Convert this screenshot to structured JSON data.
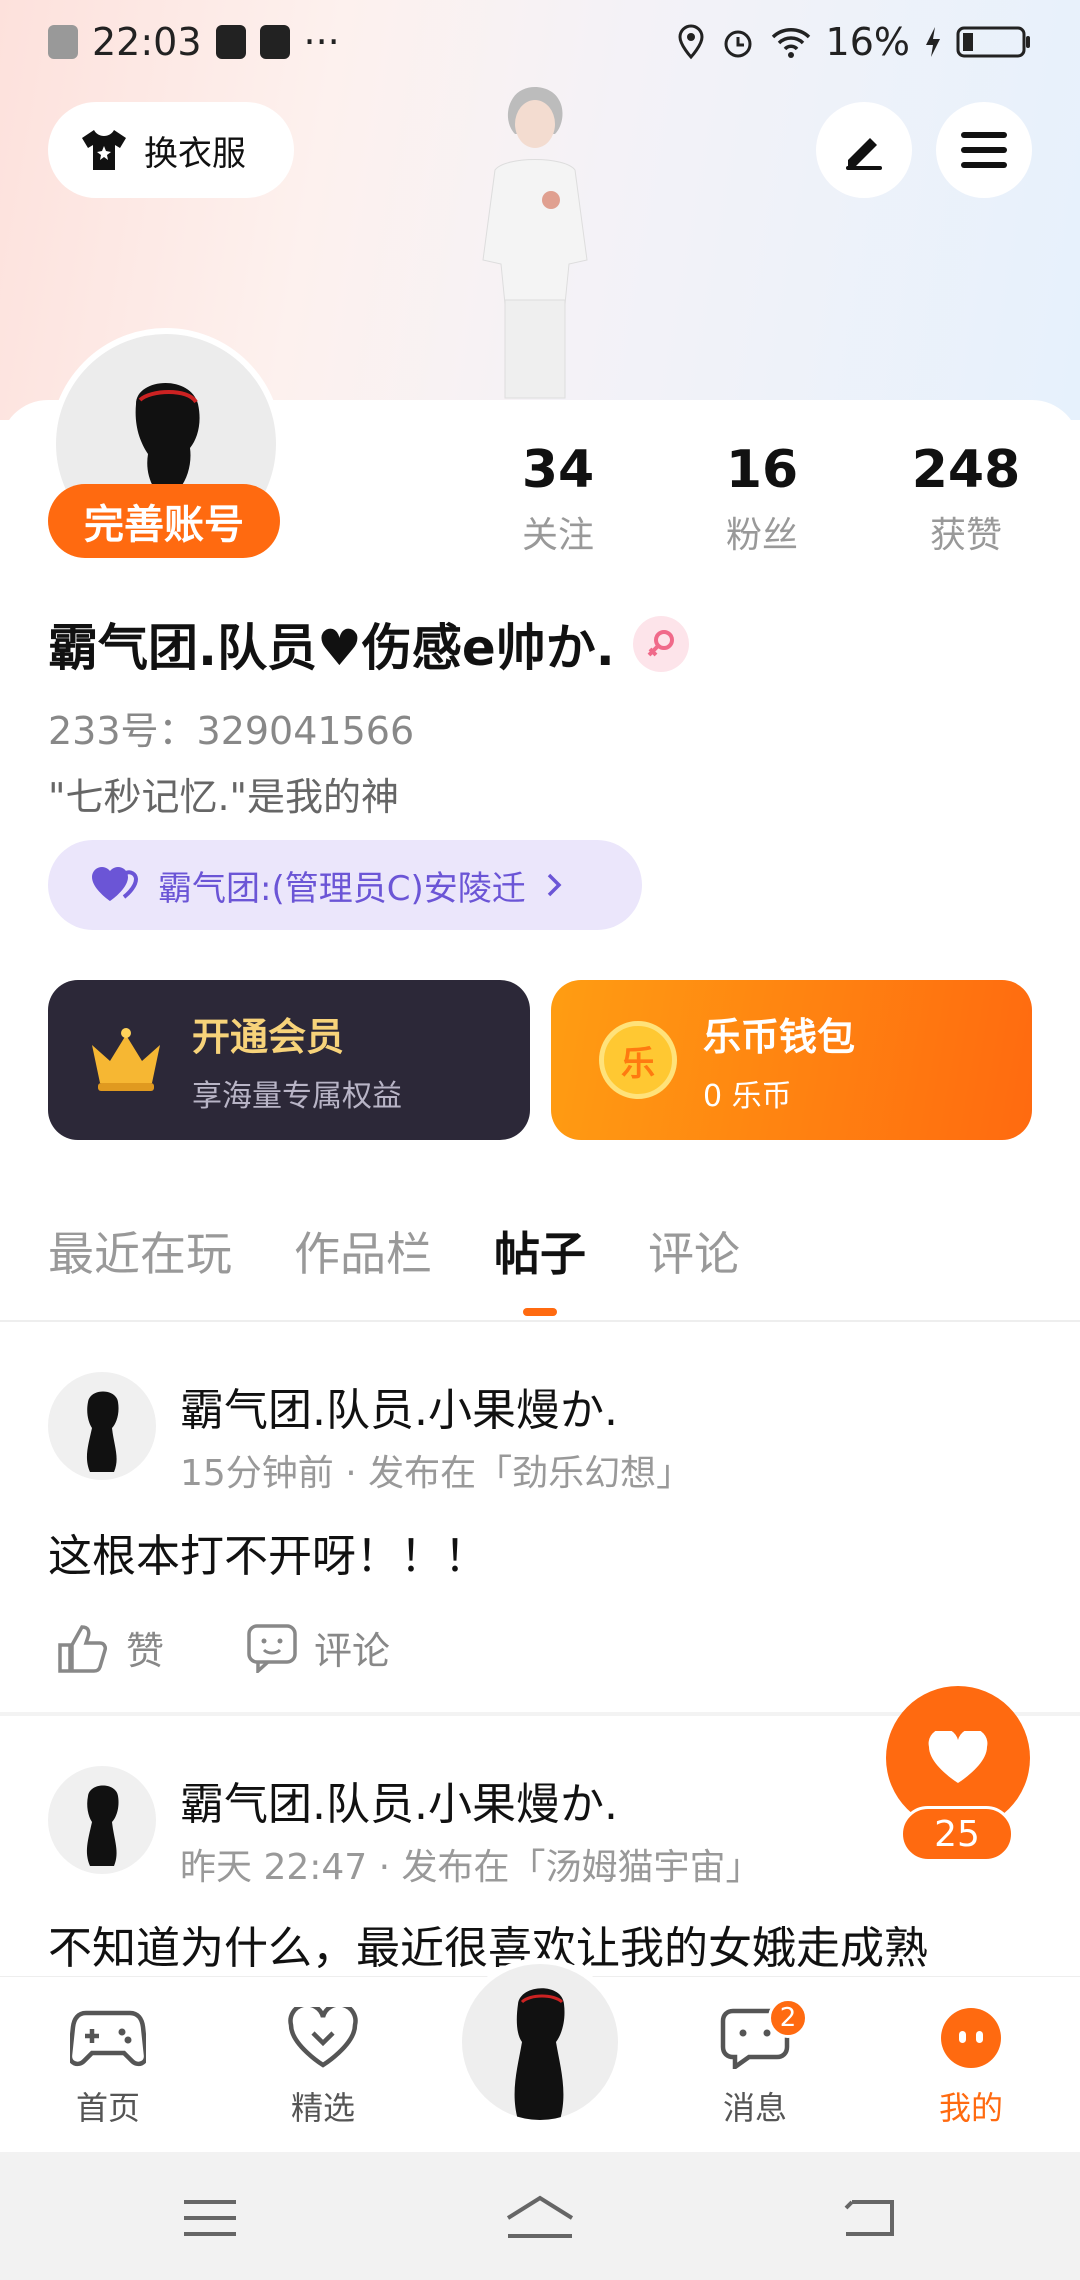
{
  "status_bar": {
    "time": "22:03",
    "dots": "···",
    "battery": "16%"
  },
  "header": {
    "dress_label": "换衣服"
  },
  "profile": {
    "complete_label": "完善账号",
    "stats": [
      {
        "value": "34",
        "label": "关注"
      },
      {
        "value": "16",
        "label": "粉丝"
      },
      {
        "value": "248",
        "label": "获赞"
      }
    ],
    "username": "霸气团.队员♥伤感e帅か.",
    "id_text": "233号：329041566",
    "signature": "\"七秒记忆.\"是我的神",
    "team_label": "霸气团:(管理员C)安陵迁"
  },
  "cards": {
    "vip": {
      "title": "开通会员",
      "subtitle": "享海量专属权益"
    },
    "wallet": {
      "icon_char": "乐",
      "title": "乐币钱包",
      "subtitle": "0 乐币"
    }
  },
  "tabs": [
    "最近在玩",
    "作品栏",
    "帖子",
    "评论"
  ],
  "active_tab": "帖子",
  "posts": [
    {
      "author": "霸气团.队员.小果熳か.",
      "meta": "15分钟前 · 发布在「劲乐幻想」",
      "text": "这根本打不开呀！！！",
      "like_label": "赞",
      "comment_label": "评论"
    },
    {
      "author": "霸气团.队员.小果熳か.",
      "meta": "昨天 22:47 · 发布在「汤姆猫宇宙」",
      "text": "不知道为什么，最近很喜欢让我的女娥走成熟"
    }
  ],
  "floating_like": {
    "count": "25"
  },
  "bottom_nav": [
    {
      "label": "首页"
    },
    {
      "label": "精选"
    },
    {
      "label": "消息",
      "badge": "2"
    },
    {
      "label": "我的"
    }
  ],
  "colors": {
    "accent": "#ff6a10",
    "vip_bg": "#2c2838",
    "team_text": "#6b55d6"
  }
}
